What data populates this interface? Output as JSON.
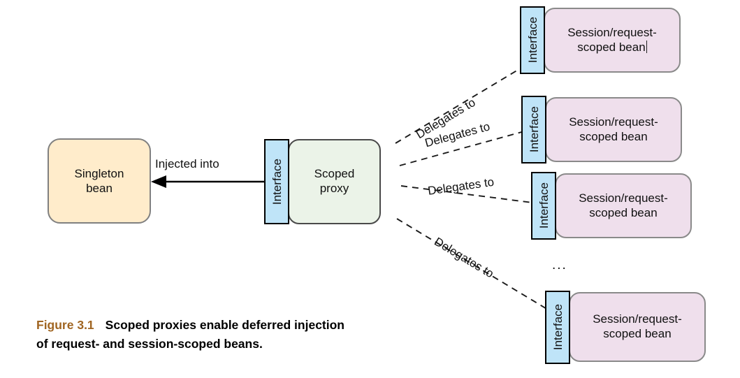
{
  "figure": {
    "caption_number": "Figure 3.1",
    "caption_text_line1": "Scoped proxies enable deferred injection",
    "caption_text_line2": "of request- and session-scoped beans.",
    "caption_number_color": "#a06522"
  },
  "nodes": {
    "singleton_bean": {
      "label": "Singleton bean",
      "line1": "Singleton",
      "line2": "bean",
      "fill": "#ffeccb",
      "stroke": "#808080"
    },
    "scoped_proxy": {
      "interface_label": "Interface",
      "line1": "Scoped",
      "line2": "proxy",
      "fill": "#ebf3e8",
      "interface_fill": "#bfe4f8",
      "stroke": "#4a4a4a"
    },
    "scoped_beans": [
      {
        "interface_label": "Interface",
        "line1": "Session/request-",
        "line2": "scoped bean",
        "has_caret": true,
        "fill": "#efdfec"
      },
      {
        "interface_label": "Interface",
        "line1": "Session/request-",
        "line2": "scoped bean",
        "has_caret": false,
        "fill": "#efdfec"
      },
      {
        "interface_label": "Interface",
        "line1": "Session/request-",
        "line2": "scoped bean",
        "has_caret": false,
        "fill": "#efdfec"
      },
      {
        "interface_label": "Interface",
        "line1": "Session/request-",
        "line2": "scoped bean",
        "has_caret": false,
        "fill": "#efdfec"
      }
    ]
  },
  "edges": {
    "injected_into": {
      "label": "Injected into",
      "style": "solid-arrow",
      "direction": "right-to-left"
    },
    "delegates": [
      {
        "label": "Delegates to",
        "style": "dashed",
        "rotation_deg": -31
      },
      {
        "label": "Delegates to",
        "style": "dashed",
        "rotation_deg": -15
      },
      {
        "label": "Delegates to",
        "style": "dashed",
        "rotation_deg": -7
      },
      {
        "label": "Delegates to",
        "style": "dashed",
        "rotation_deg": 31
      }
    ],
    "more_indicator": "..."
  }
}
